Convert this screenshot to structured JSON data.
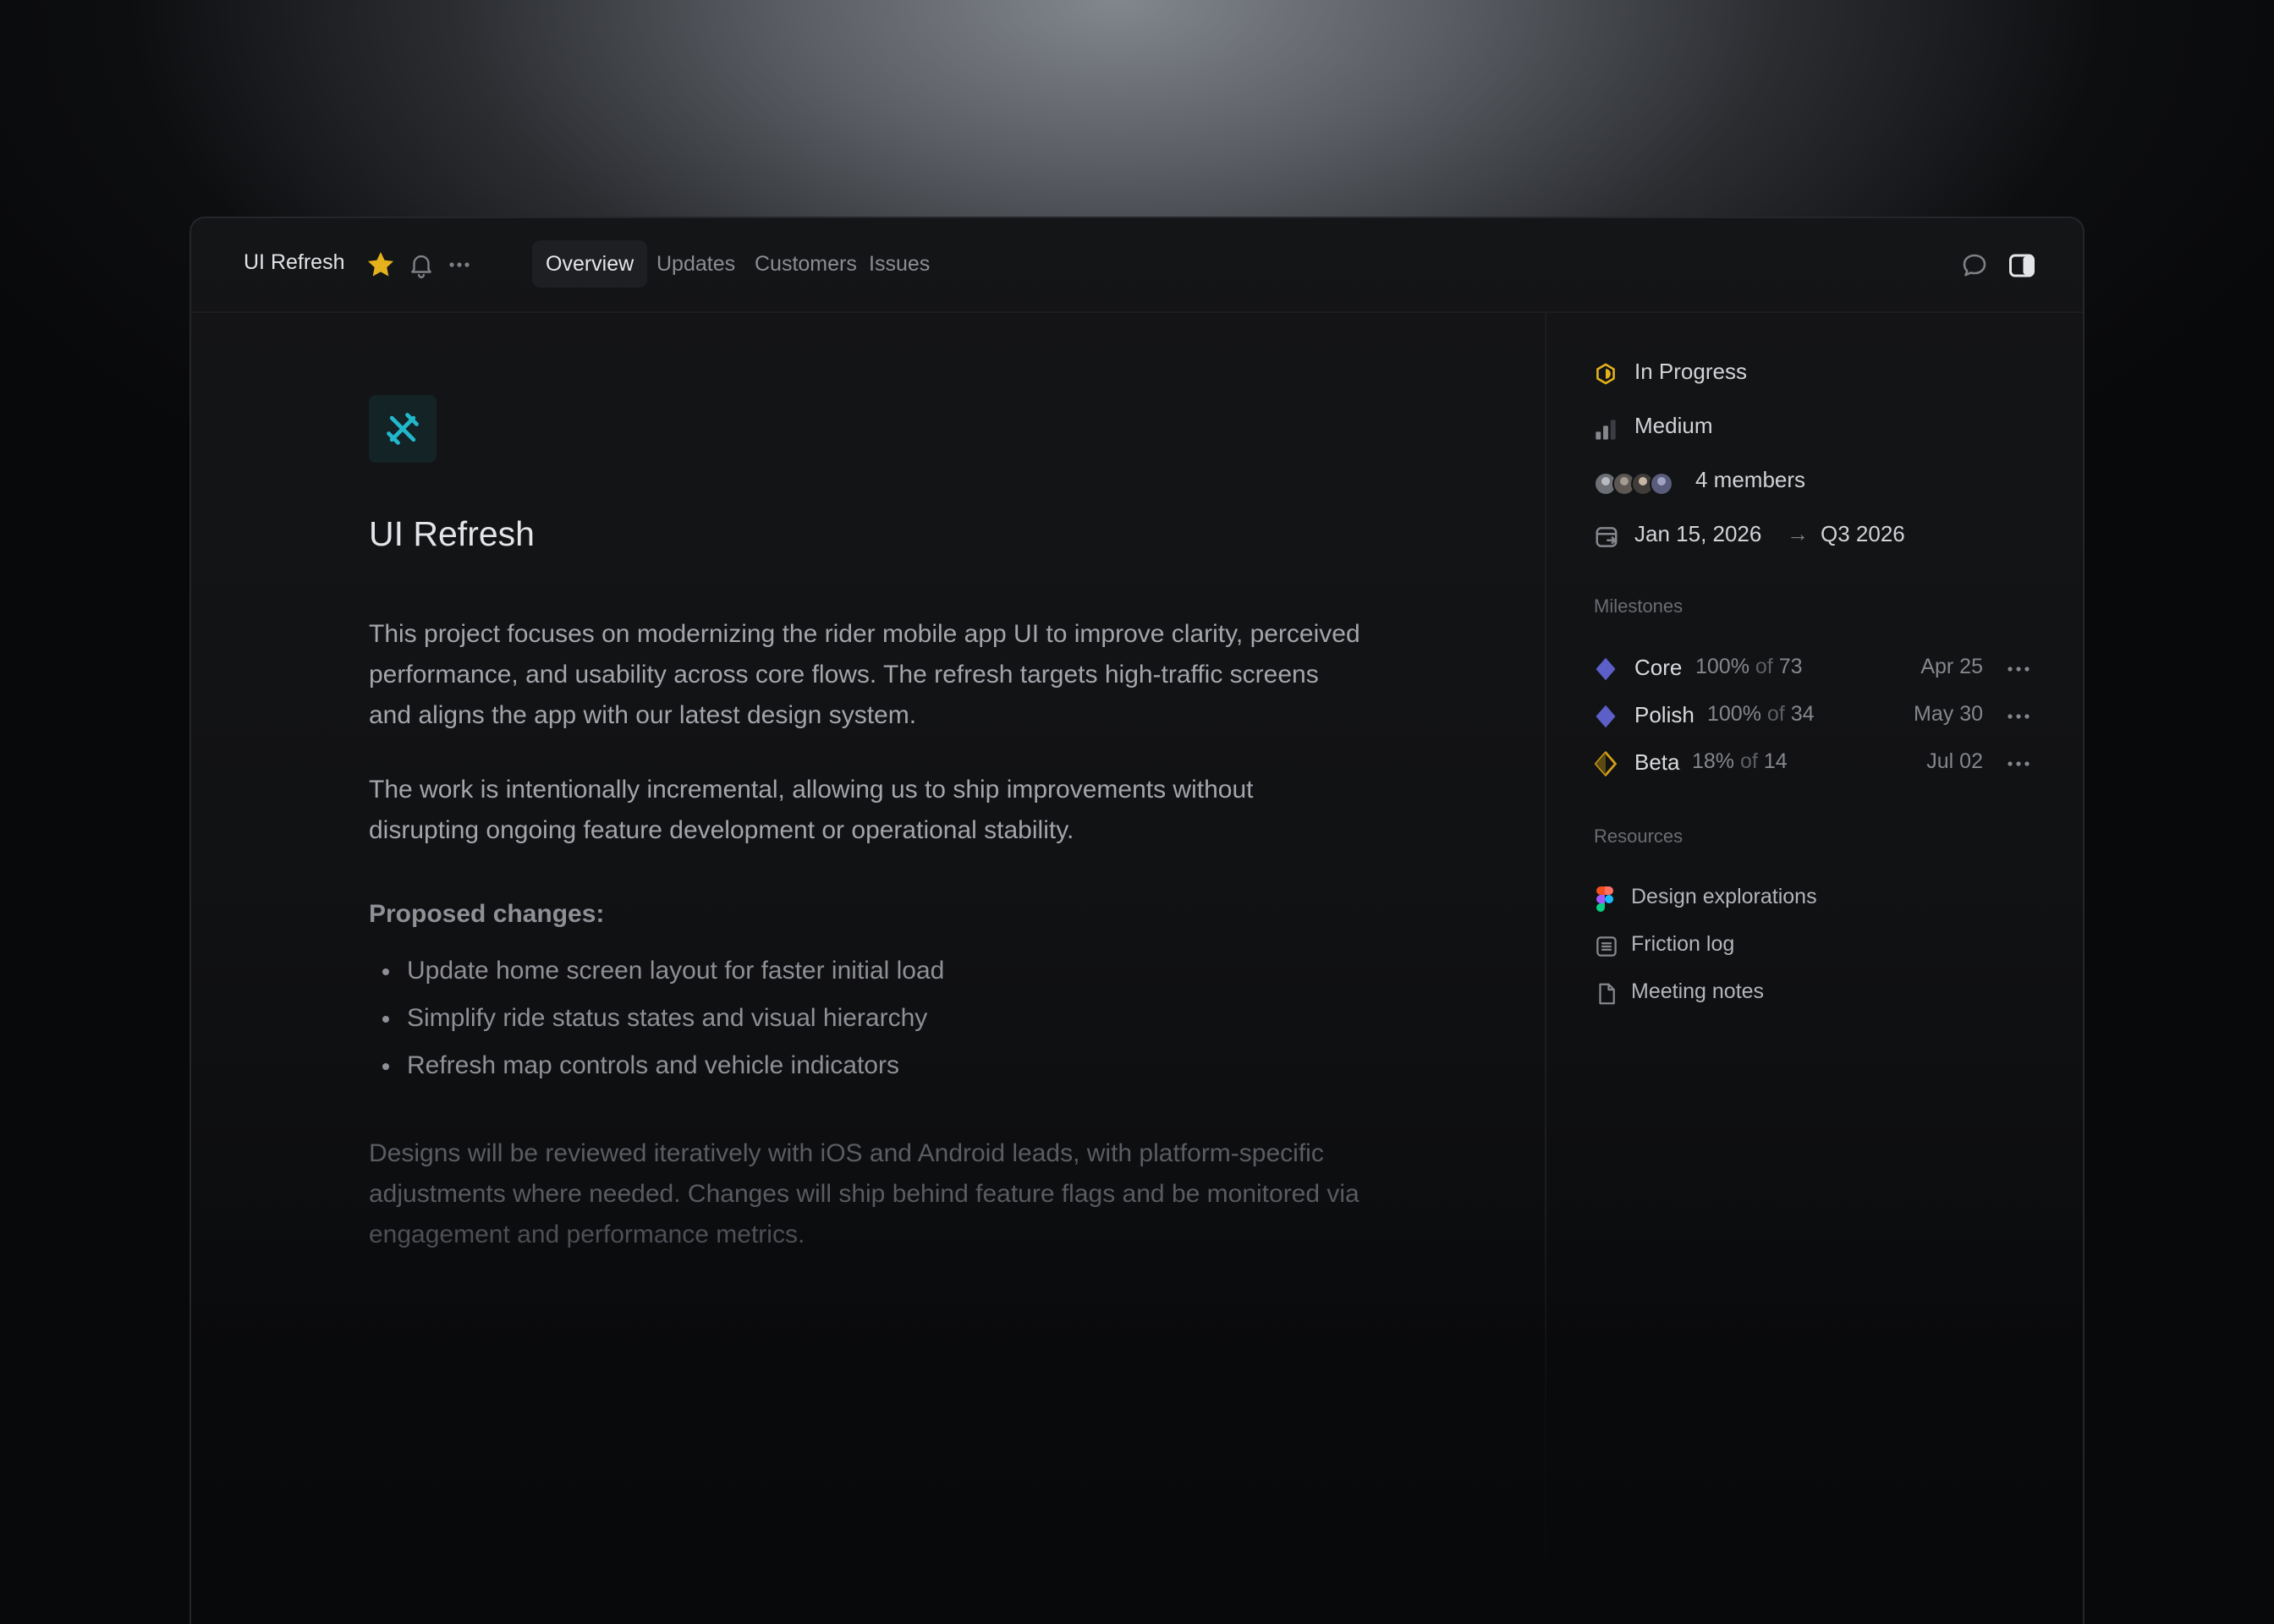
{
  "header": {
    "project_name": "UI Refresh",
    "tabs": [
      {
        "label": "Overview",
        "active": true
      },
      {
        "label": "Updates",
        "active": false
      },
      {
        "label": "Customers",
        "active": false
      },
      {
        "label": "Issues",
        "active": false
      }
    ],
    "icons": [
      "star-icon",
      "bell-icon",
      "more-icon",
      "comment-icon",
      "panel-icon"
    ],
    "star_color": "#e5b21d"
  },
  "main": {
    "project_icon": "drafting-tools-icon",
    "project_icon_color": "#22b8cc",
    "title": "UI Refresh",
    "paragraph1": "This project focuses on modernizing the rider mobile app UI to improve clarity, perceived performance, and usability across core flows. The refresh targets high‑traffic screens and aligns the app with our latest design system.",
    "paragraph2": "The work is intentionally incremental, allowing us to ship improvements without disrupting ongoing feature development or operational stability.",
    "proposed_heading": "Proposed changes:",
    "proposed_items": [
      "Update home screen layout for faster initial load",
      "Simplify ride status states and visual hierarchy",
      "Refresh map controls and vehicle indicators"
    ],
    "paragraph3": "Designs will be reviewed iteratively with iOS and Android leads, with platform‑specific adjustments where needed. Changes will ship behind feature flags and be monitored via engagement and performance metrics."
  },
  "sidebar": {
    "status": {
      "label": "In Progress",
      "icon": "in-progress-icon",
      "color": "#e5b21d"
    },
    "priority": {
      "label": "Medium",
      "icon": "priority-bars-icon"
    },
    "members": {
      "label": "4 members",
      "count": 4
    },
    "dates": {
      "start": "Jan 15, 2026",
      "arrow": "→",
      "end": "Q3 2026",
      "icon": "calendar-icon"
    },
    "milestones_heading": "Milestones",
    "milestones": [
      {
        "name": "Core",
        "percent": "100%",
        "of": "of",
        "count": "73",
        "date": "Apr 25",
        "color": "#5b5fc7"
      },
      {
        "name": "Polish",
        "percent": "100%",
        "of": "of",
        "count": "34",
        "date": "May 30",
        "color": "#5b5fc7"
      },
      {
        "name": "Beta",
        "percent": "18%",
        "of": "of",
        "count": "14",
        "date": "Jul 02",
        "color": "#d4a017"
      }
    ],
    "resources_heading": "Resources",
    "resources": [
      {
        "label": "Design explorations",
        "icon": "figma-icon"
      },
      {
        "label": "Friction log",
        "icon": "document-lines-icon"
      },
      {
        "label": "Meeting notes",
        "icon": "page-icon"
      }
    ]
  }
}
